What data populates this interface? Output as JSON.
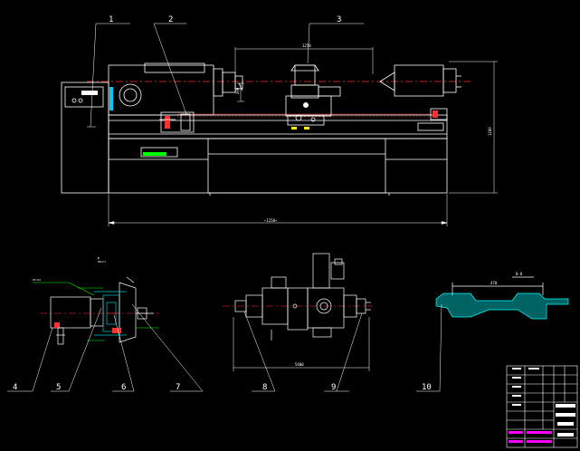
{
  "drawing": {
    "background": "#000000",
    "line_color": "#ffffff",
    "centerline_color": "#ff2020",
    "accent_yellow": "#ffff00",
    "accent_green": "#00ff00",
    "accent_cyan": "#00c8c8",
    "accent_magenta": "#ff00ff"
  },
  "callouts": [
    {
      "id": "1",
      "label": "1"
    },
    {
      "id": "2",
      "label": "2"
    },
    {
      "id": "3",
      "label": "3"
    },
    {
      "id": "4",
      "label": "4"
    },
    {
      "id": "5",
      "label": "5"
    },
    {
      "id": "6",
      "label": "6"
    },
    {
      "id": "7",
      "label": "7"
    },
    {
      "id": "8",
      "label": "8"
    },
    {
      "id": "9",
      "label": "9"
    },
    {
      "id": "10",
      "label": "10"
    }
  ]
}
